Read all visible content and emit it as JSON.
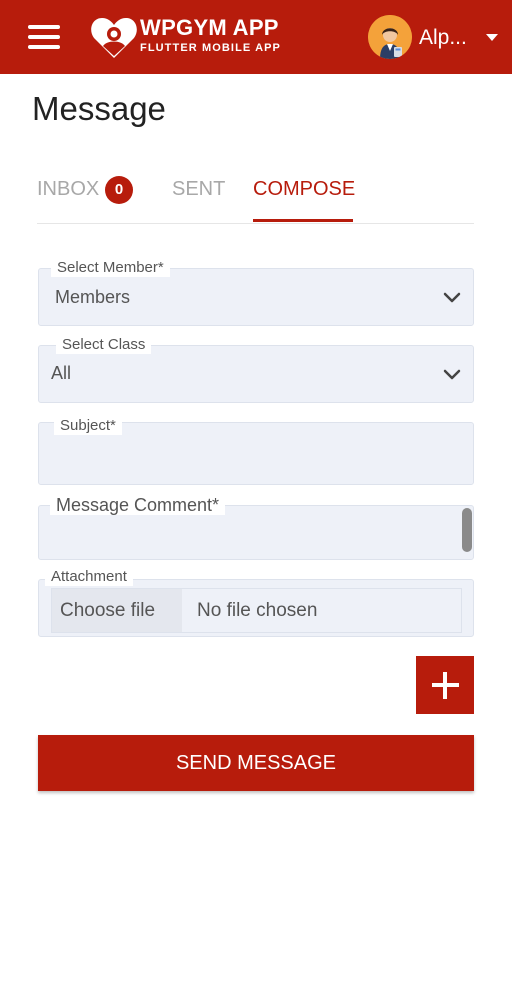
{
  "header": {
    "app_title": "WPGYM APP",
    "app_subtitle": "FLUTTER MOBILE APP",
    "user_name": "Alp...",
    "background": "#b71c0c"
  },
  "page": {
    "title": "Message"
  },
  "tabs": [
    {
      "label": "INBOX",
      "badge": "0",
      "active": false
    },
    {
      "label": "SENT",
      "active": false
    },
    {
      "label": "COMPOSE",
      "active": true
    }
  ],
  "form": {
    "member": {
      "label": "Select Member*",
      "value": "Members"
    },
    "class": {
      "label": "Select Class",
      "value": "All"
    },
    "subject": {
      "label": "Subject*",
      "value": ""
    },
    "message": {
      "label": "Message Comment*",
      "value": ""
    },
    "attachment": {
      "label": "Attachment",
      "choose_label": "Choose file",
      "status": "No file chosen"
    }
  },
  "buttons": {
    "send_label": "SEND MESSAGE",
    "add_icon": "plus-icon"
  },
  "colors": {
    "primary": "#b71c0c",
    "field_bg": "#eef1f8",
    "inactive_tab": "#a8a8a8"
  }
}
